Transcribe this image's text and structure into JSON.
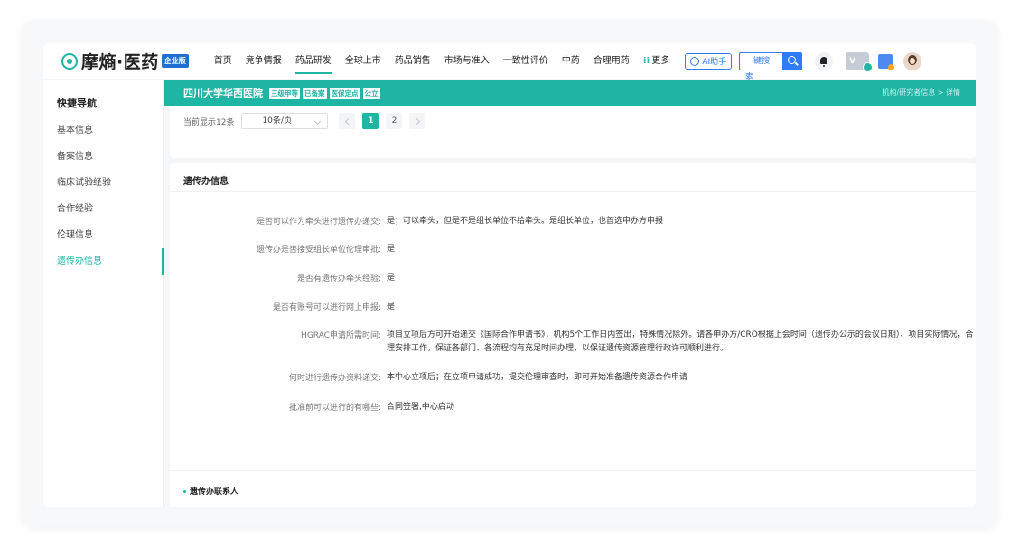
{
  "nav": {
    "logo_text": "摩熵·医药",
    "logo_badge": "企业版",
    "menu": [
      "首页",
      "竞争情报",
      "药品研发",
      "全球上市",
      "药品销售",
      "市场与准入",
      "一致性评价",
      "中药",
      "合理用药"
    ],
    "active_menu": "药品研发",
    "more_label": "更多",
    "ai_label": "AI助手",
    "search_label": "一键搜索",
    "vip_label": "V"
  },
  "sidebar": {
    "title": "快捷导航",
    "items": [
      "基本信息",
      "备案信息",
      "临床试验经验",
      "合作经验",
      "伦理信息",
      "遗传办信息"
    ],
    "active_item": "遗传办信息"
  },
  "header": {
    "hospital_name": "四川大学华西医院",
    "tags": [
      "三级甲等",
      "已备案",
      "医保定点",
      "公立"
    ],
    "breadcrumb": "机构/研究者信息 > 详情"
  },
  "pagination": {
    "summary": "当前显示12条",
    "page_size": "10条/页",
    "pages": [
      "1",
      "2"
    ],
    "current_page": "1"
  },
  "section": {
    "title": "遗传办信息",
    "rows": [
      {
        "label": "是否可以作为牵头进行遗传办递交:",
        "value": "是；可以牵头，但是不是组长单位不给牵头。是组长单位，也首选申办方申报"
      },
      {
        "label": "遗传办是否接受组长单位伦理审批:",
        "value": "是"
      },
      {
        "label": "是否有遗传办牵头经验:",
        "value": "是"
      },
      {
        "label": "是否有账号可以进行网上申报:",
        "value": "是"
      },
      {
        "label": "HGRAC申请所需时间:",
        "value": "项目立项后方可开始递交《国际合作申请书》，机构5个工作日内签出，特殊情况除外。请各申办方/CRO根据上会时间（遗传办公示的会议日期）、项目实际情况，合理安排工作，保证各部门、各流程均有充足时间办理，以保证遗传资源管理行政许可顺利进行。"
      },
      {
        "label": "何时进行遗传办资料递交:",
        "value": "本中心立项后；在立项申请成功，提交伦理审查时，即可开始准备遗传资源合作申请"
      },
      {
        "label": "批准前可以进行的有哪些:",
        "value": "合同签署,中心启动"
      }
    ]
  },
  "contacts": {
    "title": "遗传办联系人"
  }
}
